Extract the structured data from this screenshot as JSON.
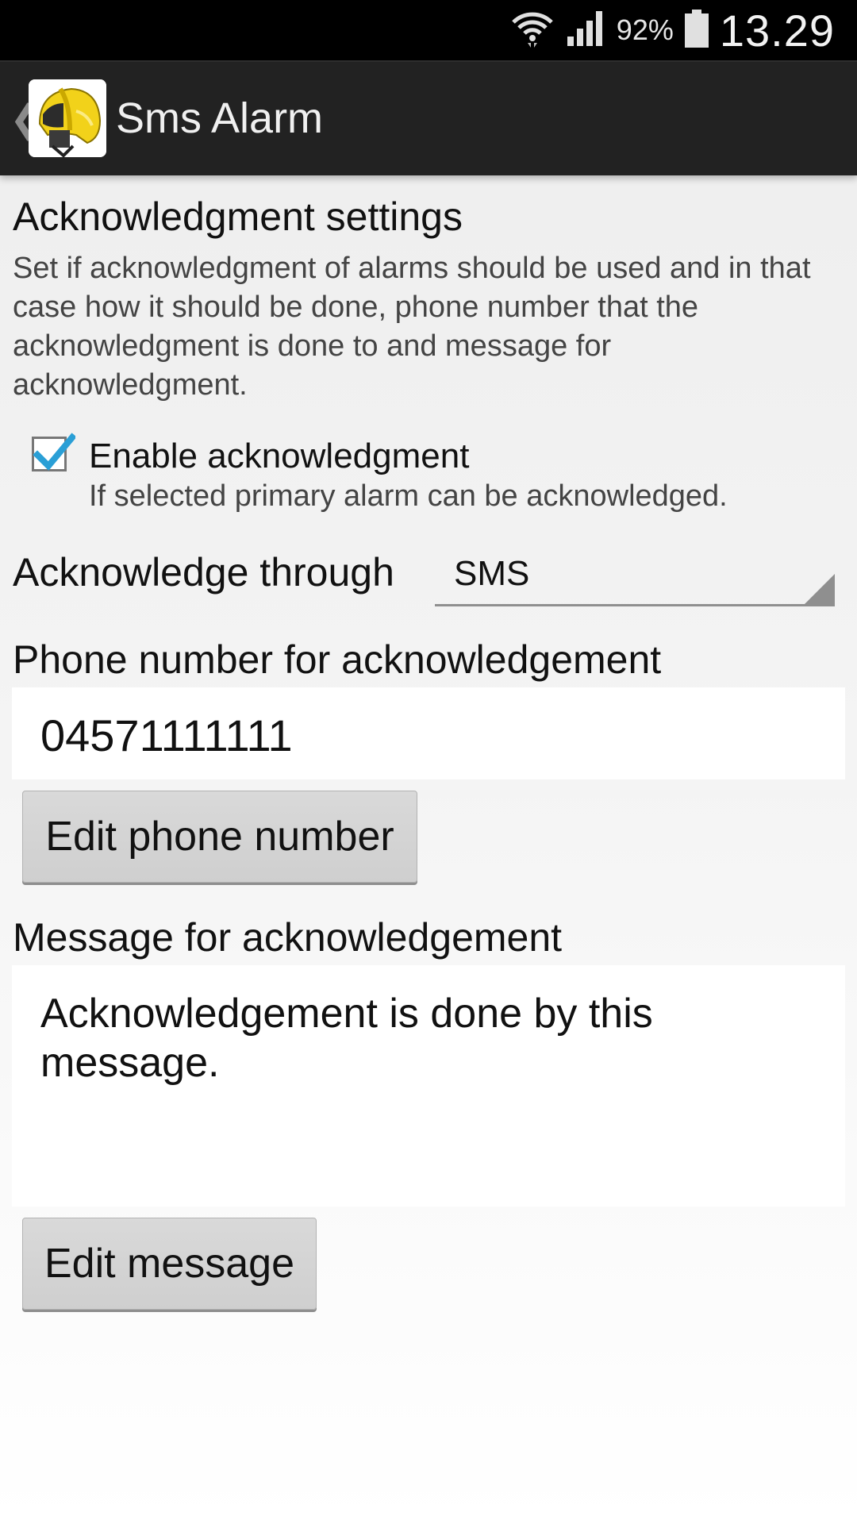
{
  "status_bar": {
    "battery_pct": "92%",
    "time": "13.29"
  },
  "action_bar": {
    "title": "Sms Alarm"
  },
  "section": {
    "title": "Acknowledgment settings",
    "description": "Set if acknowledgment of alarms should be used and in that case how it should be done, phone number that the acknowledgment is done to and message for acknowledgment."
  },
  "enable_ack": {
    "title": "Enable acknowledgment",
    "summary": "If selected primary alarm can be acknowledged.",
    "checked": true
  },
  "ack_through": {
    "label": "Acknowledge through",
    "selected": "SMS"
  },
  "phone": {
    "label": "Phone number for acknowledgement",
    "value": "04571111111",
    "button_label": "Edit phone number"
  },
  "message": {
    "label": "Message for acknowledgement",
    "value": "Acknowledgement is done by this message.",
    "button_label": "Edit message"
  },
  "colors": {
    "status_bar": "#000000",
    "action_bar": "#222222",
    "check_accent": "#2a9fd6"
  }
}
